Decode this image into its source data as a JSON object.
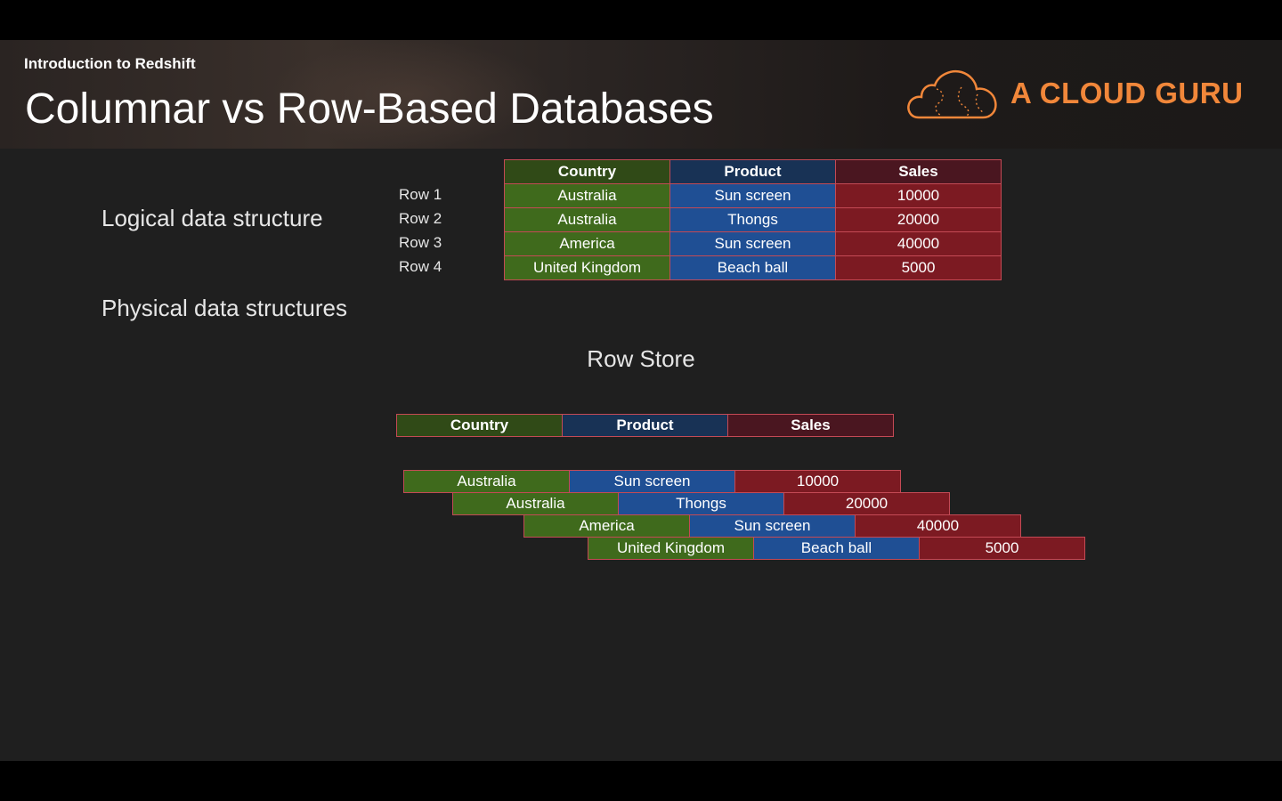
{
  "header": {
    "subtitle": "Introduction to Redshift",
    "title": "Columnar vs Row-Based Databases",
    "logo_text": "A CLOUD GURU",
    "logo_icon": "cloud-icon",
    "accent_color": "#f1873a"
  },
  "logical": {
    "label": "Logical data structure",
    "columns": [
      "Country",
      "Product",
      "Sales"
    ],
    "row_labels": [
      "Row 1",
      "Row 2",
      "Row 3",
      "Row 4"
    ],
    "rows": [
      [
        "Australia",
        "Sun screen",
        "10000"
      ],
      [
        "Australia",
        "Thongs",
        "20000"
      ],
      [
        "America",
        "Sun screen",
        "40000"
      ],
      [
        "United Kingdom",
        "Beach ball",
        "5000"
      ]
    ]
  },
  "physical": {
    "label": "Physical data structures",
    "row_store_title": "Row Store",
    "columns": [
      "Country",
      "Product",
      "Sales"
    ],
    "rows": [
      [
        "Australia",
        "Sun screen",
        "10000"
      ],
      [
        "Australia",
        "Thongs",
        "20000"
      ],
      [
        "America",
        "Sun screen",
        "40000"
      ],
      [
        "United Kingdom",
        "Beach ball",
        "5000"
      ]
    ]
  },
  "colors": {
    "country": "#3f6a1c",
    "product": "#1f4f94",
    "sales": "#7c1a22"
  }
}
